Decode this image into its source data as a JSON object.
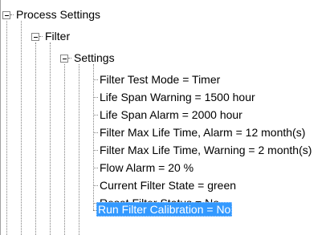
{
  "tree": {
    "root": {
      "label": "Process Settings",
      "expanded": true
    },
    "filter": {
      "label": "Filter",
      "expanded": true
    },
    "settings": {
      "label": "Settings",
      "expanded": true
    },
    "items": [
      {
        "label": "Filter Test Mode = Timer"
      },
      {
        "label": "Life Span Warning = 1500 hour"
      },
      {
        "label": "Life Span Alarm = 2000 hour"
      },
      {
        "label": "Filter Max Life Time, Alarm = 12 month(s)"
      },
      {
        "label": "Filter Max Life Time, Warning = 2 month(s)"
      },
      {
        "label": "Flow Alarm = 20 %"
      },
      {
        "label": "Current Filter State = green"
      },
      {
        "label": "Reset Filter Status = No"
      },
      {
        "label": "Run Filter Calibration = No",
        "selected": true
      }
    ]
  },
  "colors": {
    "selection": "#3399ff",
    "selection_text": "#ffffff",
    "connector": "#808080"
  }
}
